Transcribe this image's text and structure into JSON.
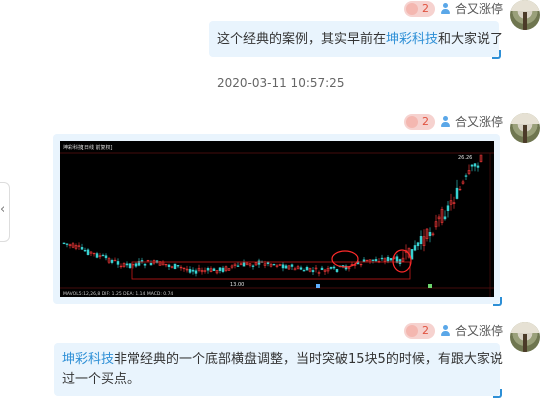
{
  "messages": [
    {
      "badge": "2",
      "user": "合又涨停",
      "text_parts": [
        "这个经典的案例，其实早前在",
        "坤彩科技",
        "和大家说了"
      ]
    },
    {
      "badge": "2",
      "user": "合又涨停",
      "timestamp": "2020-03-11 10:57:25",
      "chart_header": {
        "name": "坤彩科技",
        "tag": "[日线 前复权]",
        "high_label": "26.26",
        "low_label": "13.00",
        "indicator_row": "MAVOL5:12,26,8  DIF: 1.25  DEA: 1.14  MACD: 0.74"
      }
    },
    {
      "badge": "2",
      "user": "合又涨停",
      "text_line1_parts": [
        "坤彩科技",
        "非常经典的一个底部横盘调整，当时突破15块5的时候，有跟大家说"
      ],
      "text_line2": "过一个买点。"
    }
  ],
  "left_panel_icon": "chevron-left-icon",
  "colors": {
    "bubble": "#e9f4fd",
    "link": "#2d8fd6",
    "badge_bg": "#f6d2cf",
    "badge_text": "#e0523f",
    "candle_up": "#ff3b3b",
    "candle_down": "#38d1d1",
    "highlight": "#ff2a2a"
  }
}
